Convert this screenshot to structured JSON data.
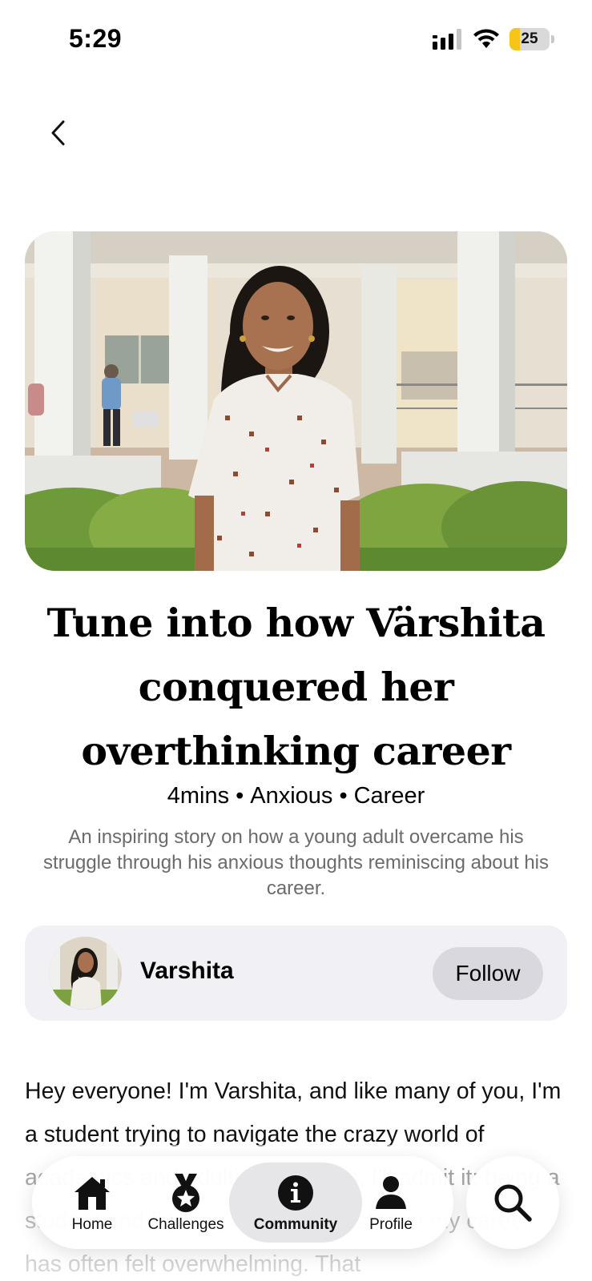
{
  "status_bar": {
    "time": "5:29",
    "battery_level": "25",
    "battery_fraction": 0.25,
    "battery_color": "#f5c518"
  },
  "story": {
    "title": "Tune into how Värshita conquered her overthinking career",
    "meta": {
      "duration": "4mins",
      "mood": "Anxious",
      "topic": "Career",
      "separator": "•"
    },
    "description": "An inspiring story on how a young adult overcame his struggle through his anxious thoughts reminiscing about his career.",
    "body": "Hey everyone! I'm Varshita, and like many of you, I'm a student trying to navigate the crazy world of academics and adulting. And yes, I'll admit it: being a student and figuring out my next step in my career has often felt overwhelming. That"
  },
  "author": {
    "name": "Varshita",
    "follow_label": "Follow"
  },
  "nav": {
    "tabs": [
      {
        "label": "Home",
        "icon": "home-icon"
      },
      {
        "label": "Challenges",
        "icon": "medal-icon"
      },
      {
        "label": "Community",
        "icon": "info-icon",
        "active": true
      },
      {
        "label": "Profile",
        "icon": "person-icon"
      }
    ],
    "search_icon": "search-icon"
  },
  "colors": {
    "card_bg": "#f0f0f5",
    "follow_bg": "#d8d8de",
    "description_text": "#6b6b6b",
    "active_tab_bg": "#e6e6e9"
  }
}
